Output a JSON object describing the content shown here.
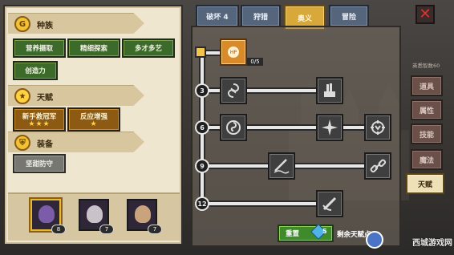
{
  "left_panel": {
    "race": {
      "title": "种族",
      "icon": "race-coin-icon",
      "items": [
        "营养摄取",
        "精细探索",
        "多才多艺",
        "创造力"
      ]
    },
    "talent": {
      "title": "天赋",
      "icon": "star-icon",
      "items": [
        {
          "label": "新手救冠军",
          "stars": "★★★"
        },
        {
          "label": "反应增强",
          "stars": "★"
        }
      ]
    },
    "equipment": {
      "title": "装备",
      "icon": "armor-icon",
      "items": [
        "坚甜防守"
      ]
    },
    "heroes": [
      {
        "level": "8",
        "selected": true
      },
      {
        "level": "7",
        "selected": false
      },
      {
        "level": "7",
        "selected": false
      }
    ]
  },
  "tabs": [
    {
      "label": "破坏 4",
      "active": false
    },
    {
      "label": "狩猎",
      "active": false
    },
    {
      "label": "奥义",
      "active": true
    },
    {
      "label": "冒险",
      "active": false
    }
  ],
  "talent_tree": {
    "root_progress": "0/5",
    "levels": [
      "3",
      "6",
      "9",
      "12"
    ],
    "nodes": [
      {
        "row": 0,
        "col": 0,
        "icon": "vortex-icon"
      },
      {
        "row": 0,
        "col": 2,
        "icon": "hand-icon"
      },
      {
        "row": 1,
        "col": 0,
        "icon": "spiral-icon"
      },
      {
        "row": 1,
        "col": 2,
        "icon": "cross-blade-icon"
      },
      {
        "row": 1,
        "col": 3,
        "icon": "gear-shield-icon"
      },
      {
        "row": 2,
        "col": 1,
        "icon": "sword-wave-icon"
      },
      {
        "row": 2,
        "col": 3,
        "icon": "chain-icon"
      },
      {
        "row": 3,
        "col": 2,
        "icon": "sword-slash-icon"
      }
    ]
  },
  "side_tabs": [
    {
      "label": "道具",
      "active": false
    },
    {
      "label": "属性",
      "active": false
    },
    {
      "label": "技能",
      "active": false
    },
    {
      "label": "魔法",
      "active": false
    },
    {
      "label": "天赋",
      "active": true
    }
  ],
  "right_hint": "英悉智数60",
  "bottom": {
    "reset_label": "重置",
    "gem_count": "5",
    "remaining_label": "剩余天赋点:"
  },
  "watermark": "西城游戏网",
  "colors": {
    "parchment": "#efe6cf",
    "green_button": "#3c6a2a",
    "orange_button": "#8c5a12",
    "active_tab": "#d9a83a",
    "close_red": "#e2322a"
  }
}
